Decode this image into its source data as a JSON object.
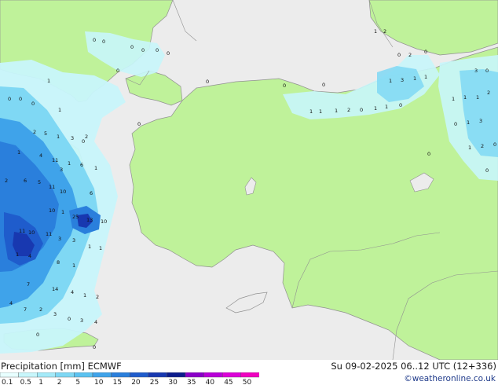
{
  "footer": {
    "title": "Precipitation [mm] ECMWF",
    "datetime": "Su 09-02-2025 06..12 UTC (12+336)",
    "credit": "©weatheronline.co.uk"
  },
  "legend": {
    "stops": [
      "0.1",
      "0.5",
      "1",
      "2",
      "5",
      "10",
      "15",
      "20",
      "25",
      "30",
      "35",
      "40",
      "45",
      "50"
    ],
    "colors": [
      "#e8ffff",
      "#c8f6fb",
      "#a4eaf8",
      "#7fd8f4",
      "#5bc2f0",
      "#3fa3ea",
      "#2a7fdc",
      "#1f5ccc",
      "#1838b0",
      "#0c1c8c",
      "#8a00c8",
      "#b800d8",
      "#dc00d8",
      "#f000c0"
    ]
  },
  "map_colors": {
    "sea": "#ececec",
    "land": "#bff29a",
    "border": "#909090",
    "light_precip": "#c8f6fb"
  },
  "map_values": [
    {
      "v": "0",
      "id": "a1"
    },
    {
      "v": "0",
      "id": "a2"
    },
    {
      "v": "0",
      "id": "a3"
    },
    {
      "v": "0",
      "id": "a4"
    },
    {
      "v": "0",
      "id": "a5"
    },
    {
      "v": "0",
      "id": "a6"
    },
    {
      "v": "0",
      "id": "a7"
    },
    {
      "v": "0",
      "id": "a8"
    },
    {
      "v": "0",
      "id": "a9"
    },
    {
      "v": "0",
      "id": "a10"
    },
    {
      "v": "1",
      "id": "a11"
    },
    {
      "v": "0",
      "id": "a12"
    },
    {
      "v": "0",
      "id": "a13"
    },
    {
      "v": "1",
      "id": "b1"
    },
    {
      "v": "2",
      "id": "b2"
    },
    {
      "v": "2",
      "id": "b3"
    },
    {
      "v": "0",
      "id": "b4"
    },
    {
      "v": "0",
      "id": "b5"
    },
    {
      "v": "1",
      "id": "b6"
    },
    {
      "v": "3",
      "id": "b7"
    },
    {
      "v": "1",
      "id": "b8"
    },
    {
      "v": "1",
      "id": "b9"
    },
    {
      "v": "1",
      "id": "b10"
    },
    {
      "v": "1",
      "id": "b11"
    },
    {
      "v": "1",
      "id": "b12"
    },
    {
      "v": "2",
      "id": "b13"
    },
    {
      "v": "0",
      "id": "b14"
    },
    {
      "v": "1",
      "id": "b15"
    },
    {
      "v": "1",
      "id": "b16"
    },
    {
      "v": "0",
      "id": "b17"
    },
    {
      "v": "3",
      "id": "c1"
    },
    {
      "v": "0",
      "id": "c2"
    },
    {
      "v": "1",
      "id": "c3"
    },
    {
      "v": "1",
      "id": "c4"
    },
    {
      "v": "1",
      "id": "c5"
    },
    {
      "v": "2",
      "id": "c6"
    },
    {
      "v": "0",
      "id": "c7"
    },
    {
      "v": "1",
      "id": "c8"
    },
    {
      "v": "3",
      "id": "c9"
    },
    {
      "v": "0",
      "id": "c10"
    },
    {
      "v": "1",
      "id": "c11"
    },
    {
      "v": "2",
      "id": "c12"
    },
    {
      "v": "0",
      "id": "c13"
    },
    {
      "v": "0",
      "id": "c14"
    },
    {
      "v": "0",
      "id": "d1"
    },
    {
      "v": "0",
      "id": "d2"
    },
    {
      "v": "1",
      "id": "d3"
    },
    {
      "v": "2",
      "id": "d4"
    },
    {
      "v": "5",
      "id": "d5"
    },
    {
      "v": "1",
      "id": "d6"
    },
    {
      "v": "3",
      "id": "d7"
    },
    {
      "v": "2",
      "id": "d8"
    },
    {
      "v": "1",
      "id": "d9"
    },
    {
      "v": "0",
      "id": "d10"
    },
    {
      "v": "4",
      "id": "d11"
    },
    {
      "v": "11",
      "id": "d12"
    },
    {
      "v": "1",
      "id": "d13"
    },
    {
      "v": "3",
      "id": "d14"
    },
    {
      "v": "6",
      "id": "d15"
    },
    {
      "v": "1",
      "id": "d16"
    },
    {
      "v": "6",
      "id": "d17"
    },
    {
      "v": "5",
      "id": "d18"
    },
    {
      "v": "11",
      "id": "d19"
    },
    {
      "v": "10",
      "id": "d20"
    },
    {
      "v": "6",
      "id": "d21"
    },
    {
      "v": "10",
      "id": "d22"
    },
    {
      "v": "1",
      "id": "d23"
    },
    {
      "v": "25",
      "id": "d24"
    },
    {
      "v": "13",
      "id": "d25"
    },
    {
      "v": "10",
      "id": "d26"
    },
    {
      "v": "11",
      "id": "d27"
    },
    {
      "v": "10",
      "id": "d28"
    },
    {
      "v": "11",
      "id": "d29"
    },
    {
      "v": "3",
      "id": "d30"
    },
    {
      "v": "3",
      "id": "d31"
    },
    {
      "v": "1",
      "id": "d32"
    },
    {
      "v": "1",
      "id": "d33"
    },
    {
      "v": "4",
      "id": "d34"
    },
    {
      "v": "1",
      "id": "d35"
    },
    {
      "v": "8",
      "id": "d36"
    },
    {
      "v": "1",
      "id": "d37"
    },
    {
      "v": "7",
      "id": "d38"
    },
    {
      "v": "14",
      "id": "d39"
    },
    {
      "v": "4",
      "id": "d40"
    },
    {
      "v": "1",
      "id": "d41"
    },
    {
      "v": "2",
      "id": "d42"
    },
    {
      "v": "4",
      "id": "d43"
    },
    {
      "v": "7",
      "id": "d44"
    },
    {
      "v": "2",
      "id": "d45"
    },
    {
      "v": "3",
      "id": "d46"
    },
    {
      "v": "0",
      "id": "d47"
    },
    {
      "v": "3",
      "id": "d48"
    },
    {
      "v": "4",
      "id": "d49"
    },
    {
      "v": "0",
      "id": "d50"
    },
    {
      "v": "0",
      "id": "d51"
    },
    {
      "v": "2",
      "id": "d52"
    }
  ]
}
